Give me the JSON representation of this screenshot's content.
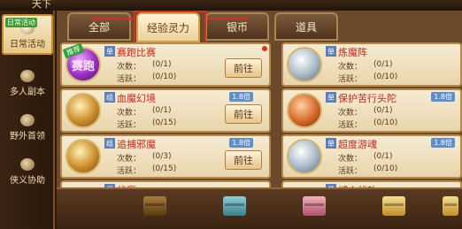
{
  "window": {
    "title": "天下"
  },
  "sidebar": {
    "items": [
      {
        "label": "日常活动",
        "badge": "日常活动",
        "active": true
      },
      {
        "label": "多人副本",
        "active": false
      },
      {
        "label": "野外首领",
        "active": false
      },
      {
        "label": "侠义协助",
        "active": false
      }
    ]
  },
  "tabs": [
    {
      "label": "全部",
      "active": false
    },
    {
      "label": "经验灵力",
      "active": true
    },
    {
      "label": "银币",
      "active": false
    },
    {
      "label": "道具",
      "active": false
    }
  ],
  "activities_left": [
    {
      "name": "赛跑比赛",
      "badge": "单",
      "avatar_text": "赛跑",
      "ribbon": "推荐",
      "count_label": "次数：",
      "count": "(0/1)",
      "active_label": "活跃：",
      "active": "(0/10)",
      "button": "前往",
      "multiplier": "",
      "has_dot": true
    },
    {
      "name": "血魔幻境",
      "badge": "组",
      "avatar_text": "",
      "ribbon": "",
      "count_label": "次数：",
      "count": "(0/1)",
      "active_label": "活跃：",
      "active": "(0/15)",
      "button": "前往",
      "multiplier": "1.8倍",
      "has_dot": false
    },
    {
      "name": "追捕邪魔",
      "badge": "组",
      "avatar_text": "",
      "ribbon": "",
      "count_label": "次数：",
      "count": "(0/3)",
      "active_label": "活跃：",
      "active": "(0/15)",
      "button": "前往",
      "multiplier": "1.8倍",
      "has_dot": false
    },
    {
      "name": "伏魔",
      "badge": "组",
      "avatar_text": "",
      "ribbon": "",
      "count_label": "",
      "count": "",
      "active_label": "",
      "active": "",
      "button": "",
      "multiplier": "",
      "has_dot": false
    }
  ],
  "activities_right": [
    {
      "name": "炼魔阵",
      "badge": "单",
      "count_label": "次数：",
      "count": "(0/1)",
      "active_label": "活跃：",
      "active": "(0/10)",
      "multiplier": ""
    },
    {
      "name": "保护苦行头陀",
      "badge": "单",
      "count_label": "次数：",
      "count": "(0/1)",
      "active_label": "活跃：",
      "active": "(0/10)",
      "multiplier": "1.8倍"
    },
    {
      "name": "超度游魂",
      "badge": "单",
      "count_label": "次数：",
      "count": "(0/1)",
      "active_label": "活跃：",
      "active": "(0/10)",
      "multiplier": "1.8倍"
    },
    {
      "name": "域人伏功",
      "badge": "单",
      "count_label": "",
      "count": "",
      "active_label": "",
      "active": "",
      "multiplier": ""
    }
  ],
  "chests": [
    "brown",
    "teal",
    "pink",
    "gold",
    "gold"
  ]
}
